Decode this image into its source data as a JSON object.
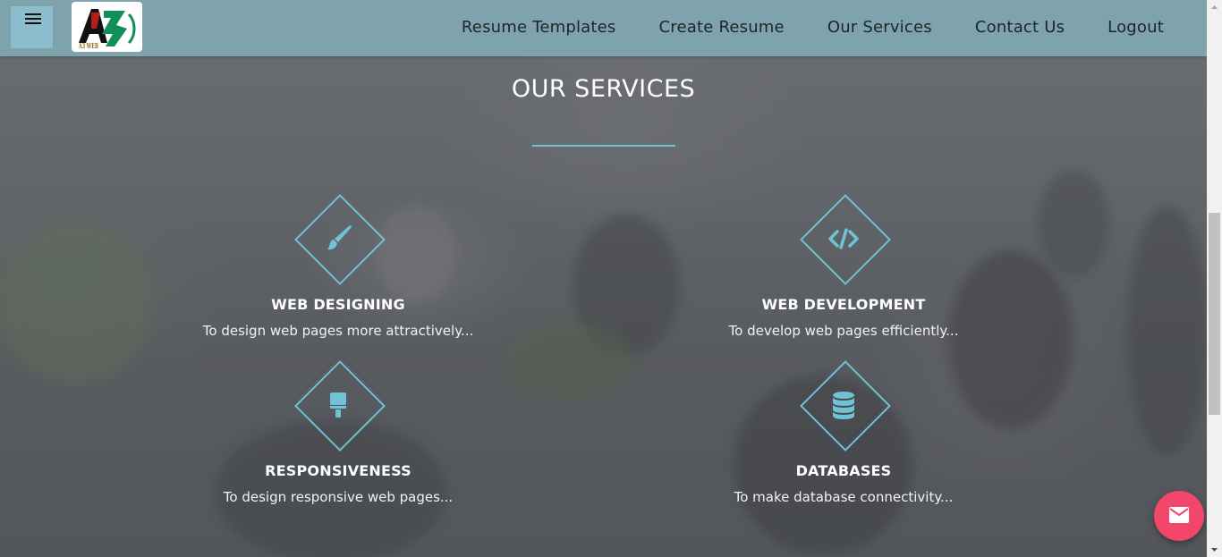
{
  "header": {
    "logo_text": "A3 WEB",
    "nav": [
      {
        "label": "Resume Templates"
      },
      {
        "label": "Create Resume"
      },
      {
        "label": "Our Services"
      },
      {
        "label": "Contact Us"
      },
      {
        "label": "Logout"
      }
    ]
  },
  "section": {
    "title": "OUR SERVICES"
  },
  "services": [
    {
      "name": "WEB DESIGNING",
      "description": "To design web pages more attractively...",
      "icon": "paint-brush-icon"
    },
    {
      "name": "WEB DEVELOPMENT",
      "description": "To develop web pages efficiently...",
      "icon": "code-icon"
    },
    {
      "name": "RESPONSIVENESS",
      "description": "To design responsive web pages...",
      "icon": "paint-roller-icon"
    },
    {
      "name": "DATABASES",
      "description": "To make database connectivity...",
      "icon": "database-icon"
    }
  ],
  "colors": {
    "header_bg": "#7fa3ad",
    "menu_button_bg": "#8bbdcc",
    "accent": "#6fc3d6",
    "fab": "#f2476a"
  }
}
